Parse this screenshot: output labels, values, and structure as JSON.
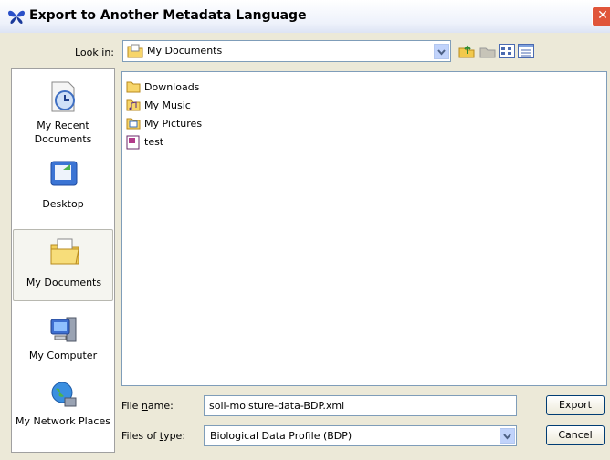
{
  "window": {
    "title": "Export to Another Metadata Language",
    "close_icon": "close-icon"
  },
  "look_in": {
    "label": "Look in:",
    "value": "My Documents"
  },
  "toolbar": [
    "up-folder-icon",
    "new-folder-icon",
    "list-view-icon",
    "details-view-icon"
  ],
  "places": [
    {
      "label": "My Recent Documents",
      "icon": "recent-documents-icon"
    },
    {
      "label": "Desktop",
      "icon": "desktop-icon"
    },
    {
      "label": "My Documents",
      "icon": "my-documents-icon",
      "selected": true
    },
    {
      "label": "My Computer",
      "icon": "my-computer-icon"
    },
    {
      "label": "My Network Places",
      "icon": "network-places-icon"
    }
  ],
  "files": [
    {
      "name": "Downloads",
      "icon": "folder-icon"
    },
    {
      "name": "My Music",
      "icon": "music-folder-icon"
    },
    {
      "name": "My Pictures",
      "icon": "pictures-folder-icon"
    },
    {
      "name": "test",
      "icon": "document-icon"
    }
  ],
  "file_name": {
    "label": "File name:",
    "value": "soil-moisture-data-BDP.xml"
  },
  "file_type": {
    "label": "Files of type:",
    "value": "Biological Data Profile (BDP)"
  },
  "buttons": {
    "export": "Export",
    "cancel": "Cancel"
  }
}
